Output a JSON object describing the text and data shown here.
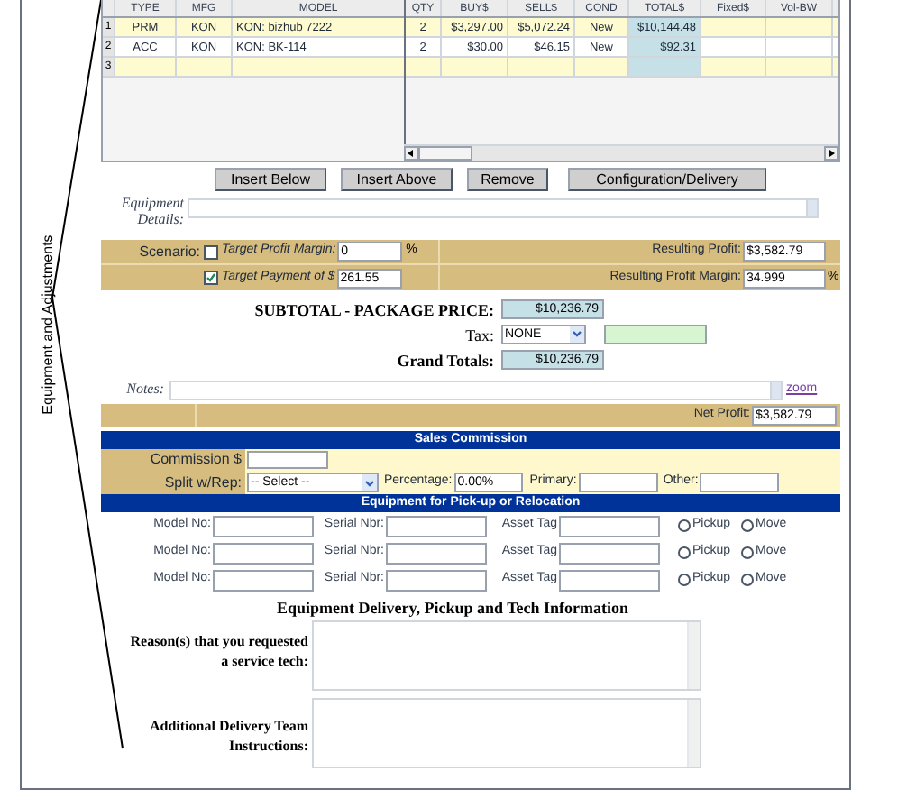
{
  "side_label": "Equipment and Adjustments",
  "grid": {
    "columns": [
      "TYPE",
      "MFG",
      "MODEL",
      "QTY",
      "BUY$",
      "SELL$",
      "COND",
      "TOTAL$",
      "Fixed$",
      "Vol-BW"
    ],
    "rows": [
      {
        "number": "1",
        "cells": [
          "PRM",
          "KON",
          "KON: bizhub 7222",
          "2",
          "$3,297.00",
          "$5,072.24",
          "New",
          "$10,144.48"
        ]
      },
      {
        "number": "2",
        "cells": [
          "ACC",
          "KON",
          "KON: BK-114",
          "2",
          "$30.00",
          "$46.15",
          "New",
          "$92.31"
        ]
      },
      {
        "number": "3"
      }
    ]
  },
  "buttons": [
    "Insert Below",
    "Insert Above",
    "Remove",
    "Configuration/Delivery"
  ],
  "equipment_details": {
    "label": "Equipment Details:"
  },
  "scenario": {
    "label": "Scenario:",
    "options": [
      {
        "label": "Target Profit Margin:",
        "value": "0",
        "unit": "%",
        "checked": false,
        "result_label": "Resulting Profit:",
        "result_value": "$3,582.79"
      },
      {
        "label": "Target Payment of $",
        "value": "261.55",
        "checked": true,
        "result_label": "Resulting Profit Margin:",
        "result_value": "34.999",
        "result_unit": "%"
      }
    ]
  },
  "subtotal": {
    "label": "SUBTOTAL - PACKAGE PRICE:",
    "value": "$10,236.79"
  },
  "tax": {
    "label": "Tax:",
    "value": "NONE"
  },
  "grand_total": {
    "label": "Grand Totals:",
    "value": "$10,236.79"
  },
  "notes": {
    "label": "Notes:",
    "link": "zoom"
  },
  "net_profit": {
    "label": "Net Profit:",
    "value": "$3,582.79"
  },
  "sales_commission": {
    "title": "Sales Commission",
    "commission_label": "Commission $",
    "split_label": "Split w/Rep:",
    "split_value": "-- Select --",
    "percentage_label": "Percentage:",
    "percentage_value": "0.00%",
    "primary_label": "Primary:",
    "other_label": "Other:"
  },
  "pickup": {
    "title": "Equipment for Pick-up or Relocation",
    "rows": [
      {
        "model_label": "Model No:",
        "serial_label": "Serial Nbr:",
        "asset_label": "Asset Tag",
        "options": [
          {
            "label": "Pickup",
            "selected": false
          },
          {
            "label": "Move",
            "selected": false
          }
        ]
      },
      {
        "model_label": "Model No:",
        "serial_label": "Serial Nbr:",
        "asset_label": "Asset Tag",
        "options": [
          {
            "label": "Pickup",
            "selected": false
          },
          {
            "label": "Move",
            "selected": false
          }
        ]
      },
      {
        "model_label": "Model No:",
        "serial_label": "Serial Nbr:",
        "asset_label": "Asset Tag",
        "options": [
          {
            "label": "Pickup",
            "selected": false
          },
          {
            "label": "Move",
            "selected": false
          }
        ]
      }
    ]
  },
  "delivery": {
    "title": "Equipment Delivery, Pickup and Tech Information",
    "fields": [
      {
        "label": "Reason(s) that you requested a service tech:"
      },
      {
        "label": "Additional Delivery Team Instructions:"
      }
    ]
  }
}
